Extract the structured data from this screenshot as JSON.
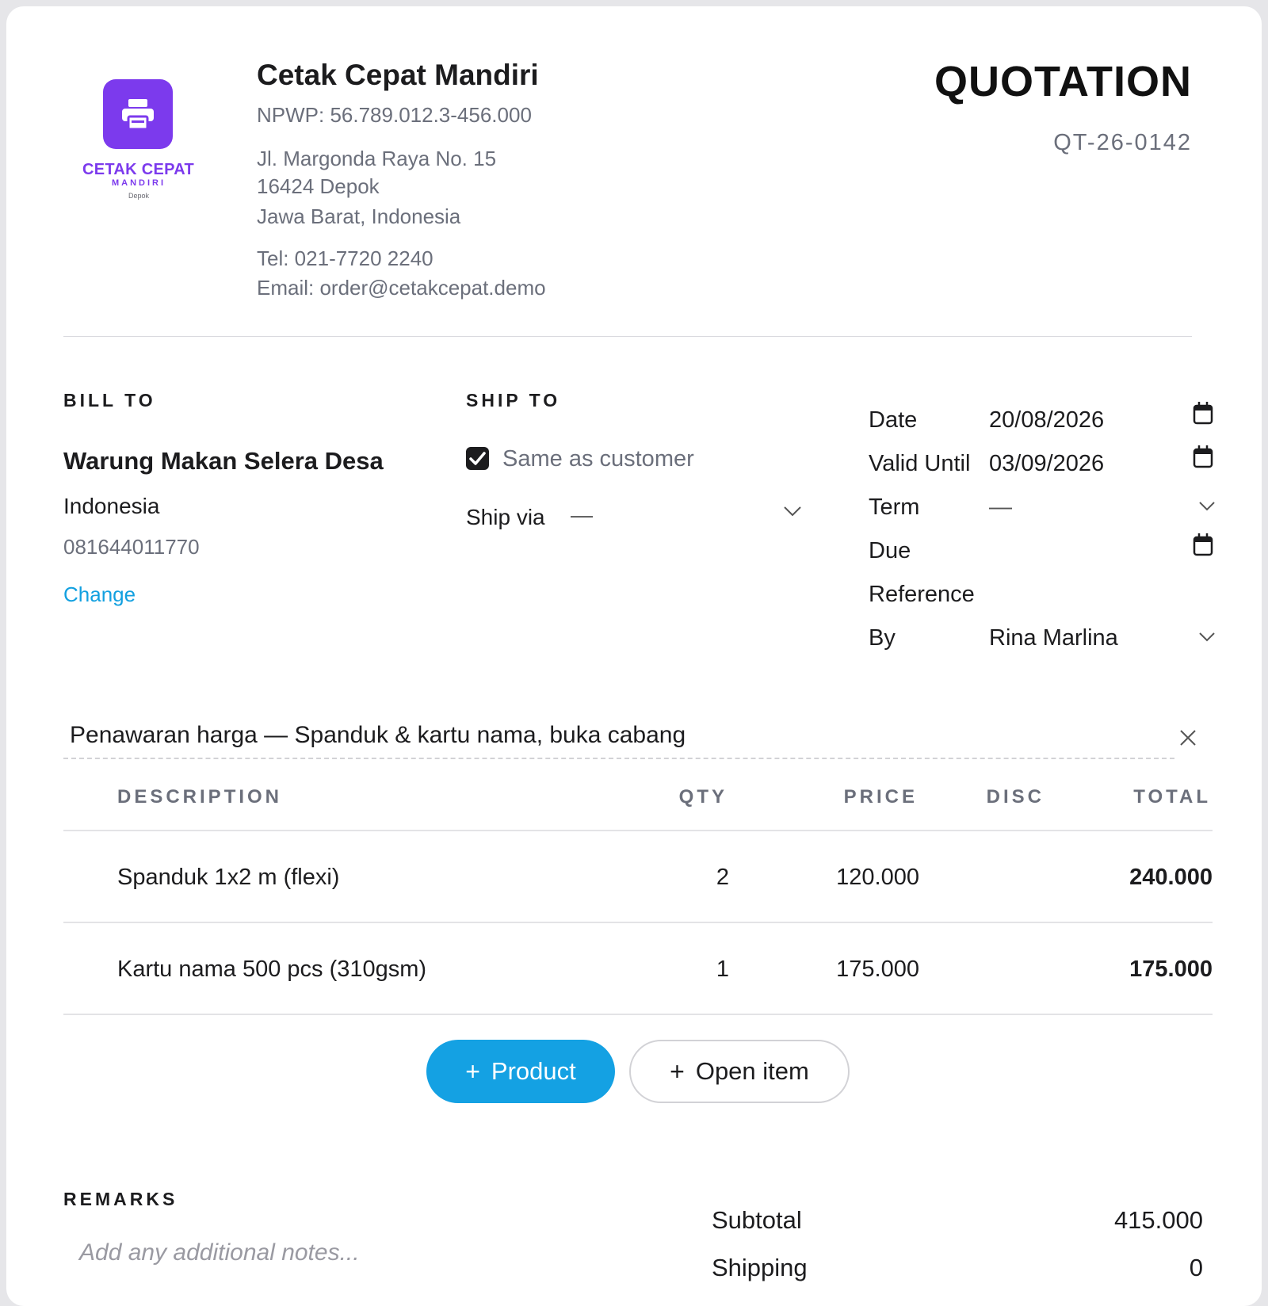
{
  "logo": {
    "brand": "CETAK CEPAT",
    "sub": "MANDIRI",
    "city": "Depok",
    "icon": "printer-icon",
    "color": "#7c3aed"
  },
  "company": {
    "name": "Cetak Cepat Mandiri",
    "npwp": "NPWP: 56.789.012.3-456.000",
    "address": [
      "Jl. Margonda Raya No. 15",
      "16424 Depok",
      "Jawa Barat, Indonesia"
    ],
    "tel": "Tel: 021-7720 2240",
    "email": "Email: order@cetakcepat.demo"
  },
  "document": {
    "title": "QUOTATION",
    "number": "QT-26-0142"
  },
  "bill_to": {
    "label": "BILL TO",
    "name": "Warung Makan Selera Desa",
    "country": "Indonesia",
    "phone": "081644011770",
    "change_link": "Change"
  },
  "ship_to": {
    "label": "SHIP TO",
    "same_as_customer": "Same as customer",
    "same_checked": true,
    "ship_via_label": "Ship via",
    "ship_via_value": "—"
  },
  "meta": {
    "date_label": "Date",
    "date_value": "20/08/2026",
    "valid_label": "Valid Until",
    "valid_value": "03/09/2026",
    "term_label": "Term",
    "term_value": "—",
    "due_label": "Due",
    "due_value": "",
    "reference_label": "Reference",
    "reference_value": "",
    "by_label": "By",
    "by_value": "Rina Marlina"
  },
  "memo": {
    "text": "Penawaran harga — Spanduk & kartu nama, buka cabang"
  },
  "table": {
    "headers": {
      "description": "DESCRIPTION",
      "qty": "QTY",
      "price": "PRICE",
      "disc": "DISC",
      "total": "TOTAL"
    },
    "rows": [
      {
        "description": "Spanduk 1x2 m (flexi)",
        "qty": "2",
        "price": "120.000",
        "disc": "",
        "total": "240.000"
      },
      {
        "description": "Kartu nama 500 pcs (310gsm)",
        "qty": "1",
        "price": "175.000",
        "disc": "",
        "total": "175.000"
      }
    ]
  },
  "buttons": {
    "add_product": "Product",
    "add_open_item": "Open item",
    "plus": "+"
  },
  "remarks": {
    "label": "REMARKS",
    "placeholder": "Add any additional notes..."
  },
  "summary": {
    "subtotal_label": "Subtotal",
    "subtotal_value": "415.000",
    "shipping_label": "Shipping",
    "shipping_value": "0"
  },
  "colors": {
    "accent": "#14a1e3",
    "brand": "#7c3aed",
    "link": "#12a0e0"
  }
}
